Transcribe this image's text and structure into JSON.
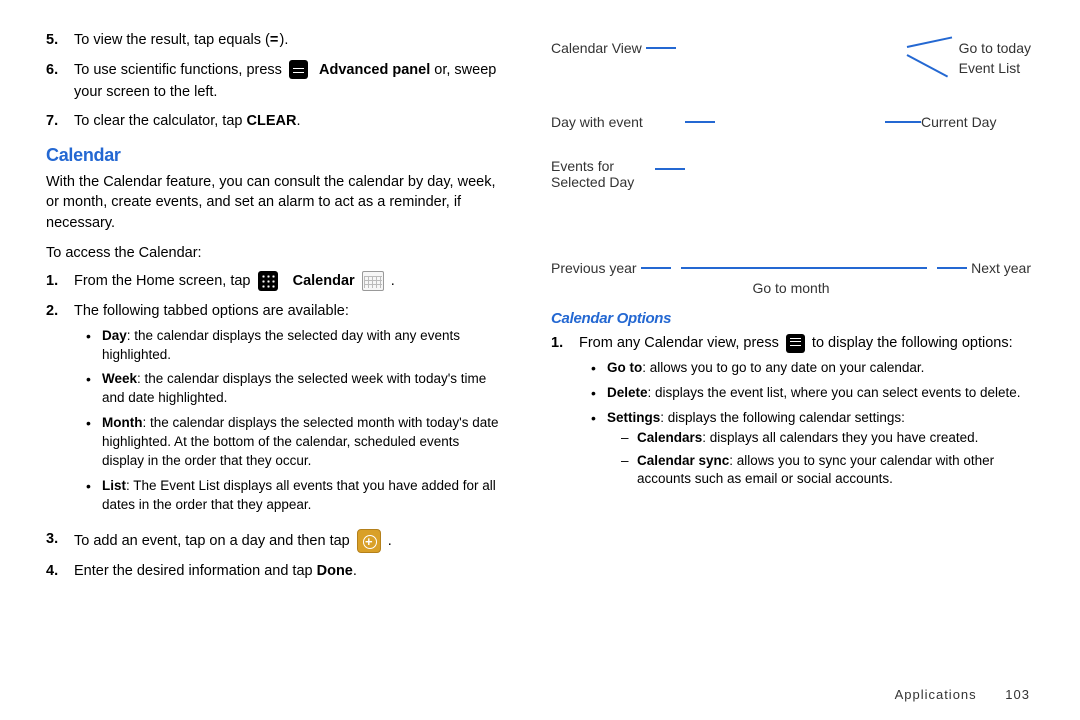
{
  "left": {
    "steps_top": [
      {
        "num": "5.",
        "text_a": "To view the result, tap equals (",
        "bold": "= ",
        "text_b": ")."
      },
      {
        "num": "6.",
        "text_a": "To use scientific functions, press ",
        "bold": "Advanced panel",
        "text_b": " or, sweep your screen to the left.",
        "icon": "panel"
      },
      {
        "num": "7.",
        "text_a": "To clear the calculator, tap ",
        "bold": "CLEAR",
        "text_b": "."
      }
    ],
    "heading": "Calendar",
    "intro": "With the Calendar feature, you can consult the calendar by day, week, or month, create events, and set an alarm to act as a reminder, if necessary.",
    "access_line": "To access the Calendar:",
    "steps_cal": {
      "s1_a": "From the Home screen, tap ",
      "s1_label": "Calendar",
      "s2": "The following tabbed options are available:",
      "bullets": [
        {
          "b": "Day",
          "t": ": the calendar displays the selected day with any events highlighted."
        },
        {
          "b": "Week",
          "t": ": the calendar displays the selected week with today's time and date highlighted."
        },
        {
          "b": "Month",
          "t": ": the calendar displays the selected month with today's date highlighted. At the bottom of the calendar, scheduled events display in the order that they occur."
        },
        {
          "b": "List",
          "t": ": The Event List displays all events that you have added for all dates in the order that they appear."
        }
      ],
      "s3_a": "To add an event, tap on a day and then tap ",
      "s3_b": ".",
      "s4_a": "Enter the desired information and tap ",
      "s4_bold": "Done",
      "s4_b": "."
    }
  },
  "right": {
    "diagram": {
      "calendar_view": "Calendar View",
      "go_today": "Go to today",
      "event_list": "Event List",
      "day_event": "Day with event",
      "current_day": "Current Day",
      "events_for": "Events for",
      "selected_day": "Selected Day",
      "prev_year": "Previous year",
      "next_year": "Next year",
      "goto_month": "Go to month"
    },
    "options": {
      "heading": "Calendar Options",
      "s1_a": "From any Calendar view, press ",
      "s1_b": " to display the following options:",
      "bullets": [
        {
          "b": "Go to",
          "t": ": allows you to go to any date on your calendar."
        },
        {
          "b": "Delete",
          "t": ": displays the event list, where you can select events to delete."
        },
        {
          "b": "Settings",
          "t": ": displays the following calendar settings:"
        }
      ],
      "dashes": [
        {
          "b": "Calendars",
          "t": ": displays all calendars they you have created."
        },
        {
          "b": "Calendar sync",
          "t": ": allows you to sync your calendar with other accounts such as email or social accounts."
        }
      ]
    }
  },
  "footer": {
    "section": "Applications",
    "page": "103"
  }
}
